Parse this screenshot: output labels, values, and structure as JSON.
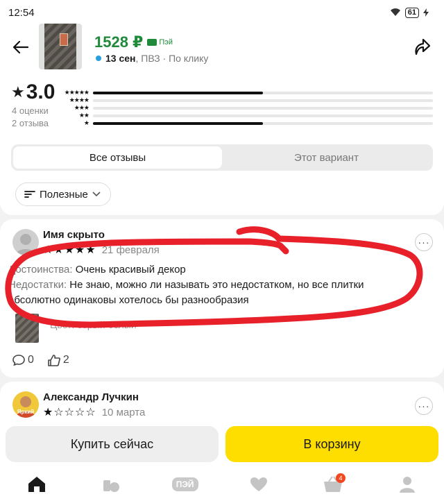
{
  "status_bar": {
    "time": "12:54",
    "battery": "61"
  },
  "header": {
    "price": "1528 ₽",
    "pay_label": "Пэй",
    "delivery_date": "13 сен",
    "delivery_info": ", ПВЗ · По клику"
  },
  "rating": {
    "score": "3.0",
    "ratings_count": "4 оценки",
    "reviews_count": "2 отзыва",
    "distribution": [
      {
        "stars": "★★★★★",
        "fraction": 0.5
      },
      {
        "stars": "★★★★",
        "fraction": 0
      },
      {
        "stars": "★★★",
        "fraction": 0
      },
      {
        "stars": "★★",
        "fraction": 0
      },
      {
        "stars": "★",
        "fraction": 0.5
      }
    ]
  },
  "tabs": {
    "all_reviews": "Все отзывы",
    "this_variant": "Этот вариант"
  },
  "sort": {
    "label": "Полезные"
  },
  "reviews": [
    {
      "author": "Имя скрыто",
      "stars": "★★★★★",
      "date": "21 февраля",
      "pros_label": "Достоинства:",
      "pros": " Очень красивый декор",
      "cons_label": "Недостатки:",
      "cons": " Не знаю, можно ли называть это недостатком, но все плитки абсолютно одинаковы хотелось бы разнообразия",
      "variant": "Цвет: серый белый",
      "comments": "0",
      "likes": "2"
    },
    {
      "author": "Александр Лучкин",
      "stars": "★☆☆☆☆",
      "date": "10 марта",
      "avatar_label": "Яркий"
    }
  ],
  "actions": {
    "buy_now": "Купить сейчас",
    "to_cart": "В корзину"
  },
  "tabbar": {
    "pay_label": "ПЭЙ",
    "cart_count": "4"
  },
  "colors": {
    "accent_yellow": "#fedd00",
    "price_green": "#1e8a3a",
    "annotation_red": "#e8202a"
  }
}
